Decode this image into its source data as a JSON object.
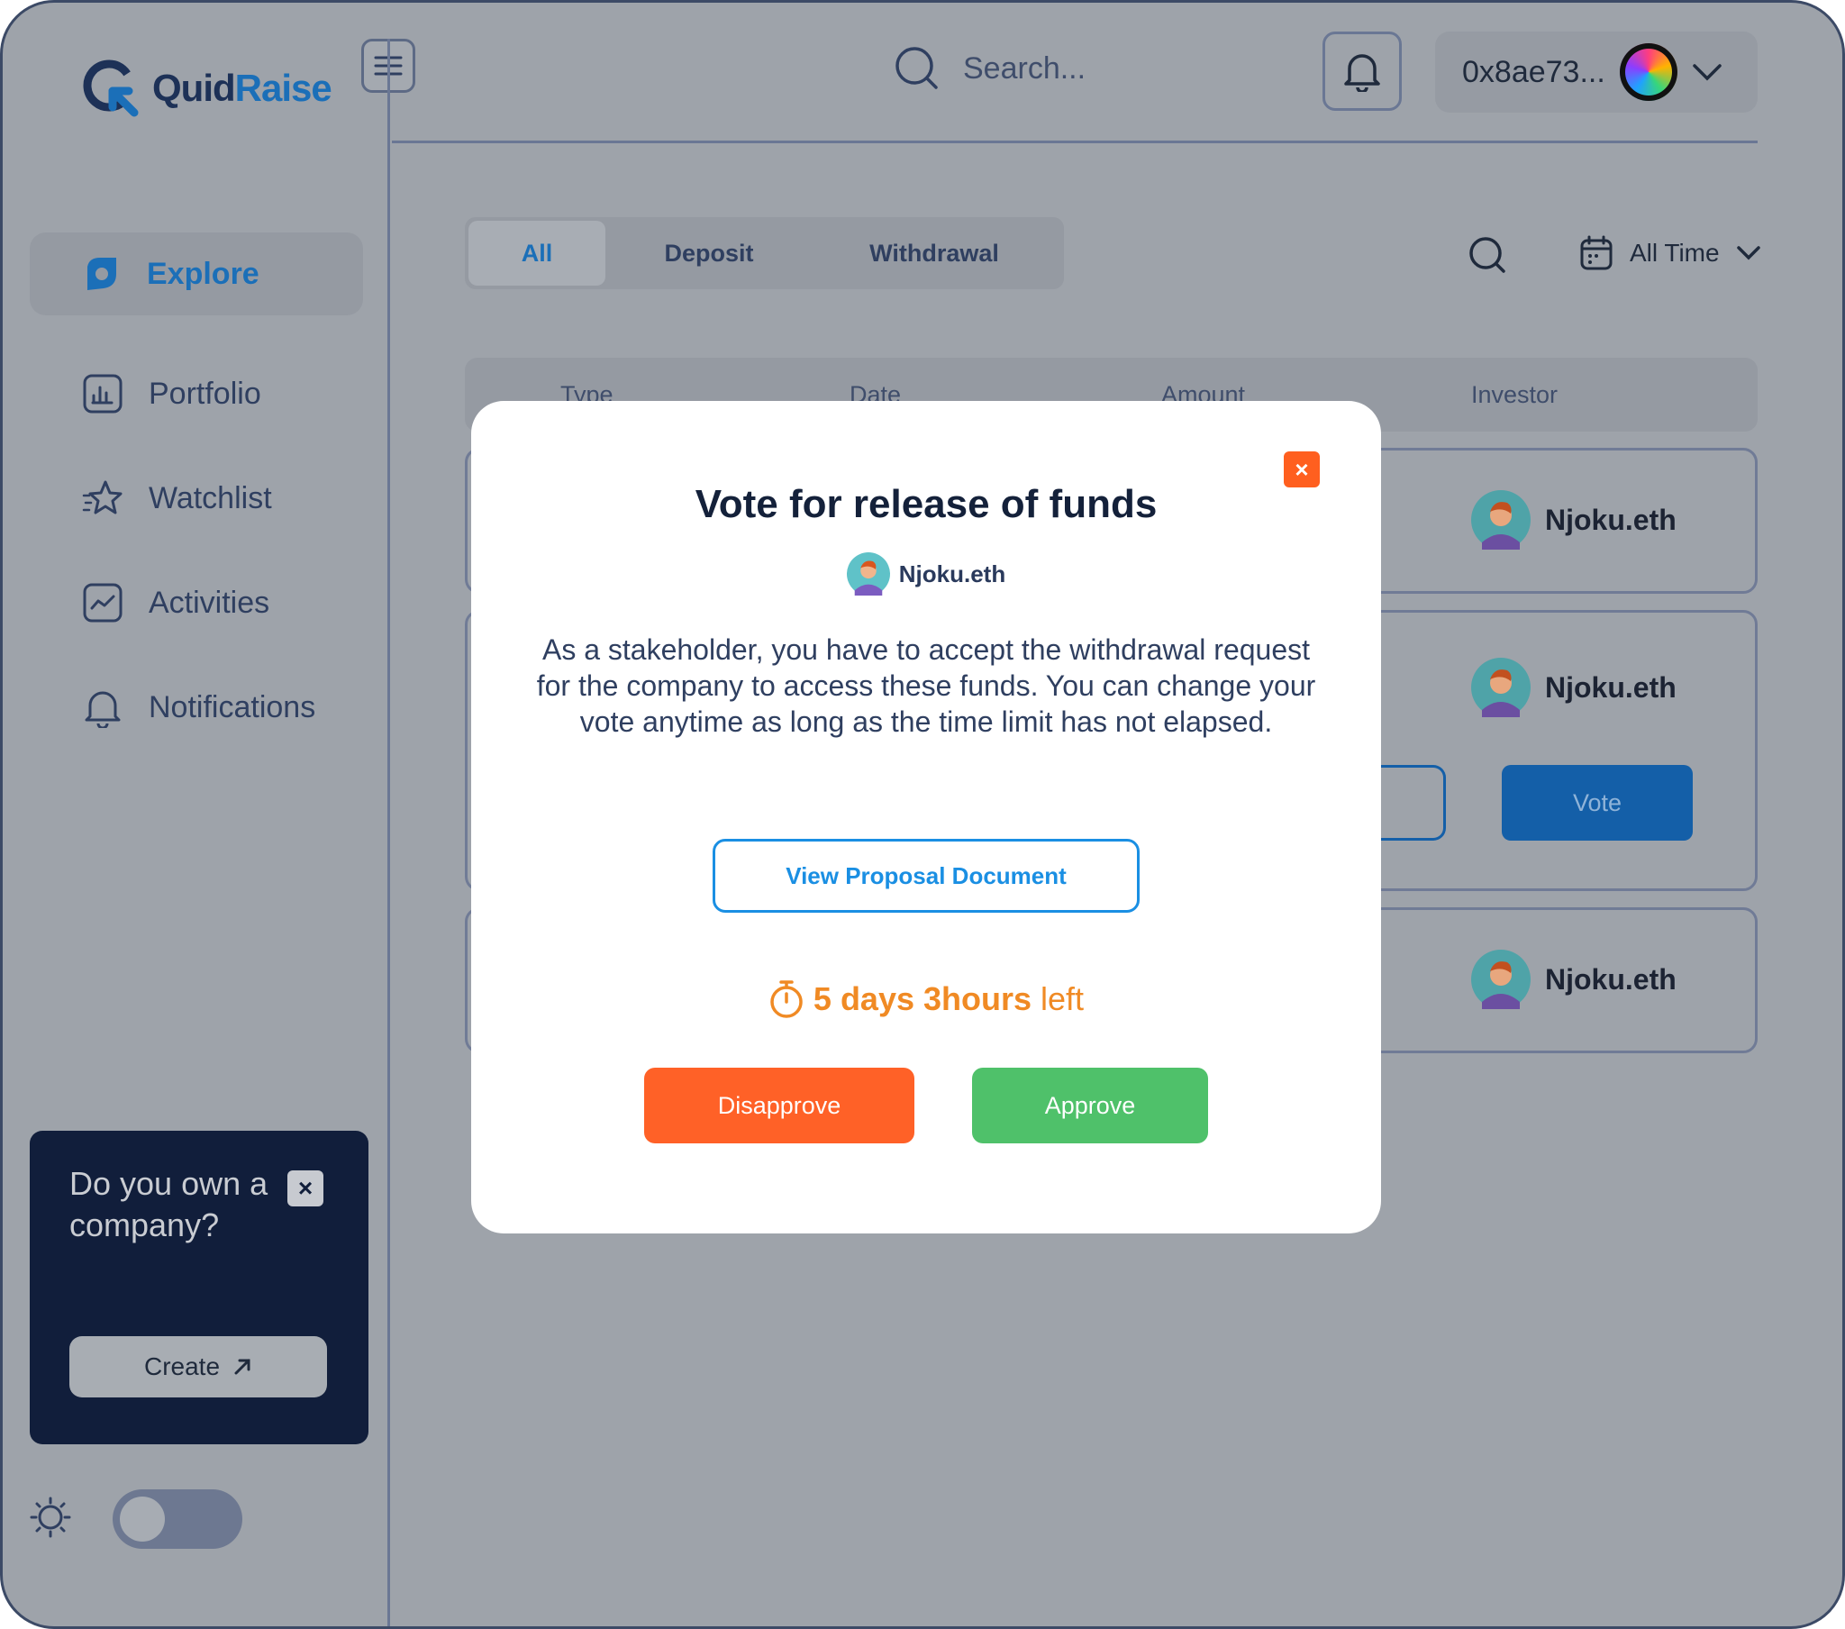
{
  "app": {
    "logo": {
      "part1": "Quid",
      "part2": "Raise"
    },
    "search_placeholder": "Search...",
    "wallet_address": "0x8ae73..."
  },
  "sidebar": {
    "items": [
      {
        "label": "Explore",
        "icon": "explore-icon",
        "active": true
      },
      {
        "label": "Portfolio",
        "icon": "portfolio-icon"
      },
      {
        "label": "Watchlist",
        "icon": "star-icon"
      },
      {
        "label": "Activities",
        "icon": "activities-icon"
      },
      {
        "label": "Notifications",
        "icon": "bell-icon"
      }
    ],
    "promo": {
      "title": "Do you own a company?",
      "button": "Create"
    }
  },
  "main": {
    "tabs": [
      {
        "label": "All",
        "active": true
      },
      {
        "label": "Deposit"
      },
      {
        "label": "Withdrawal"
      }
    ],
    "filter_label": "All Time",
    "columns": [
      "Type",
      "Date",
      "Amount",
      "Investor"
    ],
    "rows": [
      {
        "investor": "Njoku.eth"
      },
      {
        "investor": "Njoku.eth",
        "action": "Vote"
      },
      {
        "investor": "Njoku.eth"
      }
    ]
  },
  "modal": {
    "title": "Vote for release of funds",
    "user": "Njoku.eth",
    "description": "As a stakeholder, you have to accept the withdrawal request for the company to access these funds. You can change your vote anytime as long as the time limit has not elapsed.",
    "doc_button": "View Proposal Document",
    "timer_strong": "5 days 3hours",
    "timer_suffix": "left",
    "disapprove": "Disapprove",
    "approve": "Approve"
  },
  "colors": {
    "brand": "#1b6fb8",
    "approve": "#4fc16a",
    "disapprove": "#ff6127",
    "timer": "#f08a24",
    "overlay": "#9ea3aa"
  }
}
